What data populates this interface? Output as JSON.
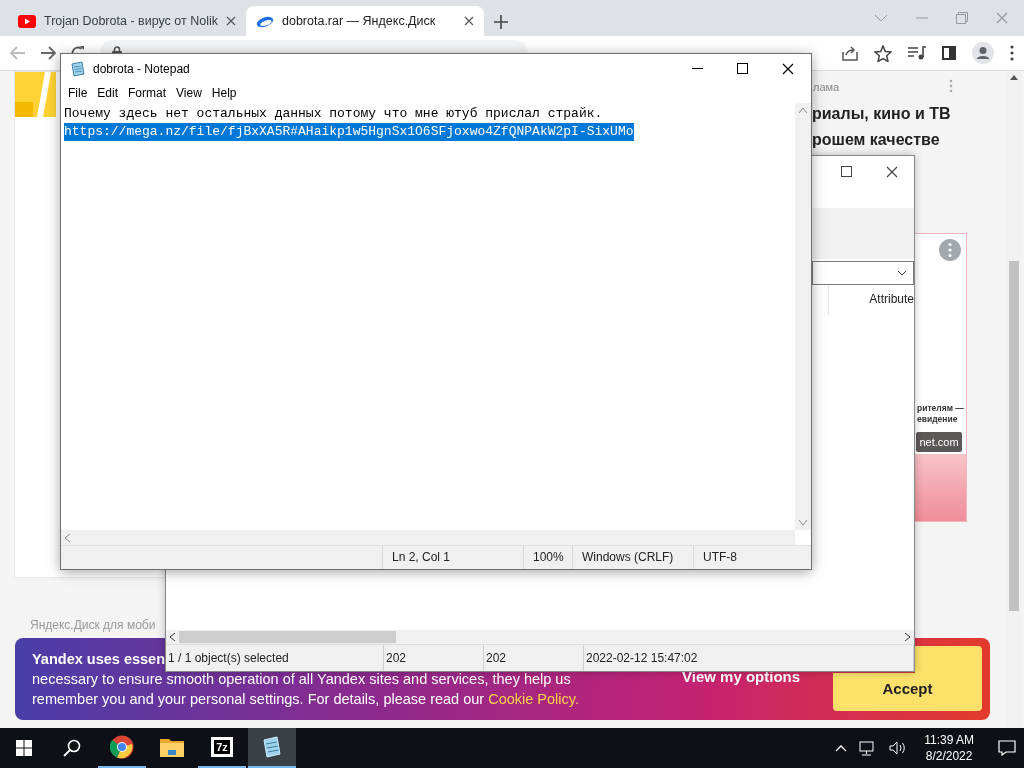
{
  "browser": {
    "tabs": [
      {
        "kind": "video",
        "title": "Trojan Dobrota - вирус от Nolik",
        "selected": false
      },
      {
        "kind": "disk",
        "title": "dobrota.rar — Яндекс.Диск",
        "selected": true
      }
    ],
    "page": {
      "ad_label": "лама",
      "ad_title": [
        "риалы, кино и ТВ",
        "рошем качестве"
      ],
      "banner_lines": [
        "рителям —",
        "евидение"
      ],
      "banner_logo": "net.com",
      "footer_link": "Яндекс.Диск для моби"
    },
    "cookie_banner": {
      "lead": "Yandex uses essen",
      "lines": [
        "necessary to ensure smooth operation of all Yandex sites and services, they help us",
        "remember you and your personal settings. For details, please read our "
      ],
      "link": "Cookie Policy.",
      "options_button": "View my options",
      "accept_button": "Accept"
    }
  },
  "archive_window": {
    "columns": [
      "Attribute"
    ],
    "status": [
      "1 / 1 object(s) selected",
      "202",
      "202",
      "2022-02-12 15:47:02"
    ]
  },
  "notepad": {
    "title": "dobrota - Notepad",
    "menu": [
      "File",
      "Edit",
      "Format",
      "View",
      "Help"
    ],
    "lines": [
      {
        "text": "Почему здесь нет остальных данных потому что мне ютуб прислал страйк.",
        "selected": false
      },
      {
        "text": "https://mega.nz/file/fjBxXA5R#AHaikp1w5HgnSx1O6SFjoxwo4ZfQNPAkW2pI-SixUMo",
        "selected": true
      }
    ],
    "status": [
      "Ln 2, Col 1",
      "100%",
      "Windows (CRLF)",
      "UTF-8"
    ]
  },
  "taskbar": {
    "apps": [
      {
        "kind": "browser",
        "running": true,
        "selected": false
      },
      {
        "kind": "folder",
        "running": false,
        "selected": false
      },
      {
        "kind": "archiver",
        "label": "7z",
        "running": true,
        "selected": false
      },
      {
        "kind": "notepad",
        "running": true,
        "selected": true
      }
    ],
    "time": "11:39 AM",
    "date": "8/2/2022"
  }
}
